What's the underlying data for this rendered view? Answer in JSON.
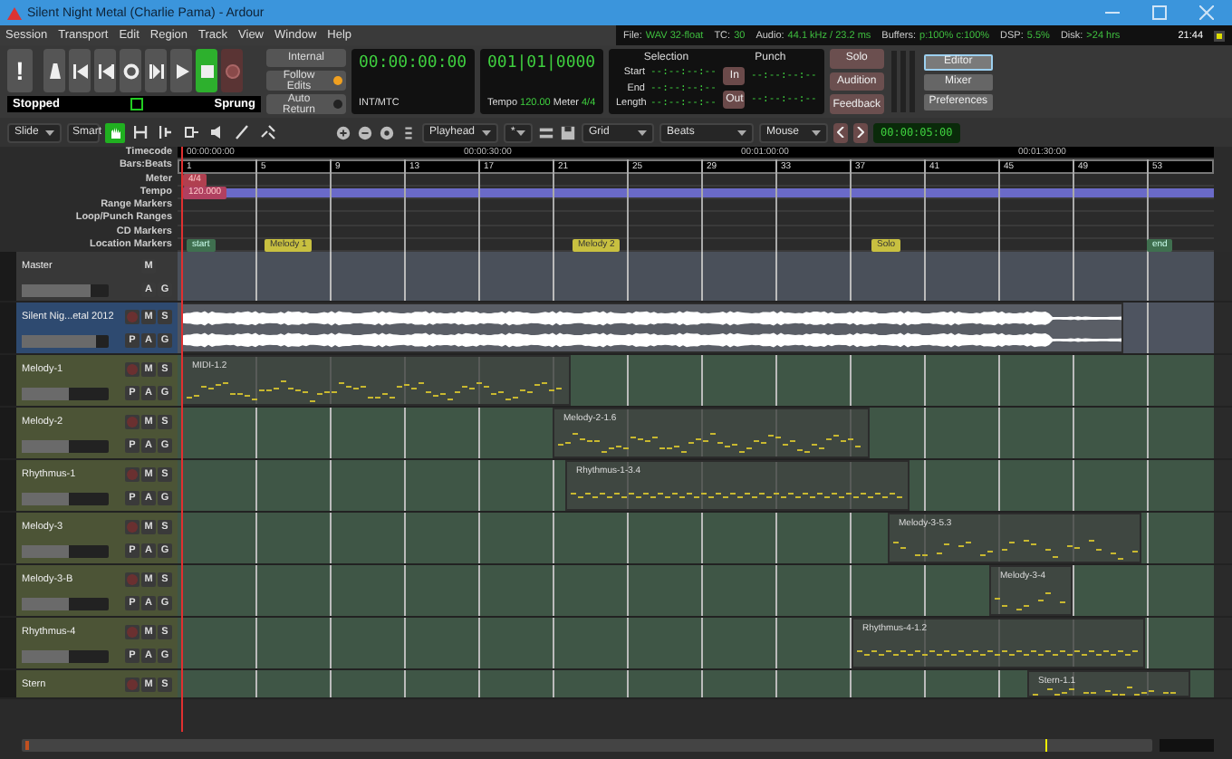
{
  "window": {
    "title": "Silent Night Metal (Charlie Pama) - Ardour"
  },
  "menu": [
    "Session",
    "Transport",
    "Edit",
    "Region",
    "Track",
    "View",
    "Window",
    "Help"
  ],
  "status": [
    {
      "label": "File:",
      "value": "WAV 32-float"
    },
    {
      "label": "TC:",
      "value": "30"
    },
    {
      "label": "Audio:",
      "value": "44.1 kHz / 23.2 ms"
    },
    {
      "label": "Buffers:",
      "value": "p:100% c:100%"
    },
    {
      "label": "DSP:",
      "value": "5.5%"
    },
    {
      "label": "Disk:",
      "value": ">24 hrs"
    }
  ],
  "clock": "21:44",
  "transport": {
    "buttons": [
      {
        "kind": "panic",
        "label": "!",
        "on": false
      },
      {
        "kind": "metronome",
        "on": false
      },
      {
        "kind": "goto-start",
        "on": false
      },
      {
        "kind": "goto-end",
        "on": false
      },
      {
        "kind": "loop",
        "on": false
      },
      {
        "kind": "play-range",
        "on": false
      },
      {
        "kind": "play",
        "on": false
      },
      {
        "kind": "stop",
        "on": true
      },
      {
        "kind": "record",
        "on": false
      }
    ],
    "state": "Stopped",
    "mode": "Sprung"
  },
  "sync": [
    {
      "label": "Internal",
      "kind": "button"
    },
    {
      "label": "Follow Edits",
      "kind": "toggle",
      "on": true
    },
    {
      "label": "Auto Return",
      "kind": "toggle",
      "on": false
    }
  ],
  "primary_clock": {
    "time": "00:00:00:00",
    "source": "INT/MTC"
  },
  "secondary_clock": {
    "time": "001|01|0000",
    "tempo_label": "Tempo",
    "tempo": "120.00",
    "meter_label": "Meter",
    "meter": "4/4"
  },
  "selection": {
    "title": "Selection",
    "rows": [
      {
        "label": "Start",
        "value": "--:--:--:--"
      },
      {
        "label": "End",
        "value": "--:--:--:--"
      },
      {
        "label": "Length",
        "value": "--:--:--:--"
      }
    ]
  },
  "punch": {
    "title": "Punch",
    "rows": [
      {
        "button": "In",
        "value": "--:--:--:--"
      },
      {
        "button": "Out",
        "value": "--:--:--:--"
      }
    ]
  },
  "monitor_buttons": [
    "Solo",
    "Audition",
    "Feedback"
  ],
  "windows": [
    {
      "label": "Editor",
      "selected": true
    },
    {
      "label": "Mixer",
      "selected": false
    },
    {
      "label": "Preferences",
      "selected": false
    }
  ],
  "edit_toolbar": {
    "edit_mode": "Slide",
    "tool_mode": "Smart",
    "tools": [
      {
        "kind": "grab",
        "selected": true
      },
      {
        "kind": "range",
        "selected": false
      },
      {
        "kind": "cut",
        "selected": false
      },
      {
        "kind": "stretch",
        "selected": false
      },
      {
        "kind": "audition",
        "selected": false
      },
      {
        "kind": "draw",
        "selected": false
      },
      {
        "kind": "internal-edit",
        "selected": false
      }
    ],
    "zoom_focus": "Playhead",
    "visible_tracks": "*",
    "snap": "Grid",
    "grid": "Beats",
    "draw_mode": "Mouse",
    "nudge": "00:00:05:00"
  },
  "rulers": {
    "labels": [
      "Timecode",
      "Bars:Beats",
      "Meter",
      "Tempo",
      "Range Markers",
      "Loop/Punch Ranges",
      "CD Markers",
      "Location Markers"
    ],
    "timecode": [
      "00:00:00:00",
      "00:00:30:00",
      "00:01:00:00",
      "00:01:30:00"
    ],
    "bars": [
      "1",
      "5",
      "9",
      "13",
      "17",
      "21",
      "25",
      "29",
      "33",
      "37",
      "41",
      "45",
      "49",
      "53"
    ],
    "meter_marker": "4/4",
    "tempo_marker": "120.000",
    "locations": [
      {
        "label": "start",
        "kind": "session"
      },
      {
        "label": "Melody 1",
        "kind": "marker"
      },
      {
        "label": "Melody 2",
        "kind": "marker"
      },
      {
        "label": "Solo",
        "kind": "marker"
      },
      {
        "label": "end",
        "kind": "session"
      }
    ]
  },
  "tracks": [
    {
      "name": "Master",
      "kind": "master",
      "selected": false,
      "level": 0.8,
      "buttons": [
        "M"
      ],
      "buttons_2": [
        "A",
        "G"
      ]
    },
    {
      "name": "Silent Nig...etal 2012",
      "kind": "audio",
      "selected": true,
      "rec": false,
      "level": 0.85,
      "buttons": [
        "M",
        "S"
      ],
      "buttons_2": [
        "P",
        "A",
        "G"
      ],
      "regions": [
        {
          "kind": "audio"
        }
      ]
    },
    {
      "name": "Melody-1",
      "kind": "midi",
      "selected": false,
      "rec": false,
      "level": 0.55,
      "buttons": [
        "M",
        "S"
      ],
      "buttons_2": [
        "P",
        "A",
        "G"
      ],
      "regions": [
        {
          "kind": "midi",
          "name": "MIDI-1.2"
        }
      ]
    },
    {
      "name": "Melody-2",
      "kind": "midi",
      "selected": false,
      "rec": false,
      "level": 0.55,
      "buttons": [
        "M",
        "S"
      ],
      "buttons_2": [
        "P",
        "A",
        "G"
      ],
      "regions": [
        {
          "kind": "midi",
          "name": "Melody-2-1.6"
        }
      ]
    },
    {
      "name": "Rhythmus-1",
      "kind": "midi",
      "selected": false,
      "rec": false,
      "level": 0.55,
      "buttons": [
        "M",
        "S"
      ],
      "buttons_2": [
        "P",
        "A",
        "G"
      ],
      "regions": [
        {
          "kind": "midi",
          "name": "Rhythmus-1-3.4"
        }
      ]
    },
    {
      "name": "Melody-3",
      "kind": "midi",
      "selected": false,
      "rec": false,
      "level": 0.55,
      "buttons": [
        "M",
        "S"
      ],
      "buttons_2": [
        "P",
        "A",
        "G"
      ],
      "regions": [
        {
          "kind": "midi",
          "name": "Melody-3-5.3"
        }
      ]
    },
    {
      "name": "Melody-3-B",
      "kind": "midi",
      "selected": false,
      "rec": false,
      "level": 0.55,
      "buttons": [
        "M",
        "S"
      ],
      "buttons_2": [
        "P",
        "A",
        "G"
      ],
      "regions": [
        {
          "kind": "midi",
          "name": "Melody-3-4"
        }
      ]
    },
    {
      "name": "Rhythmus-4",
      "kind": "midi",
      "selected": false,
      "rec": false,
      "level": 0.55,
      "buttons": [
        "M",
        "S"
      ],
      "buttons_2": [
        "P",
        "A",
        "G"
      ],
      "regions": [
        {
          "kind": "midi",
          "name": "Rhythmus-4-1.2"
        }
      ]
    },
    {
      "name": "Stern",
      "kind": "midi",
      "selected": false,
      "rec": false,
      "buttons": [
        "M",
        "S"
      ],
      "regions": [
        {
          "kind": "midi",
          "name": "Stern-1.1"
        }
      ]
    }
  ]
}
